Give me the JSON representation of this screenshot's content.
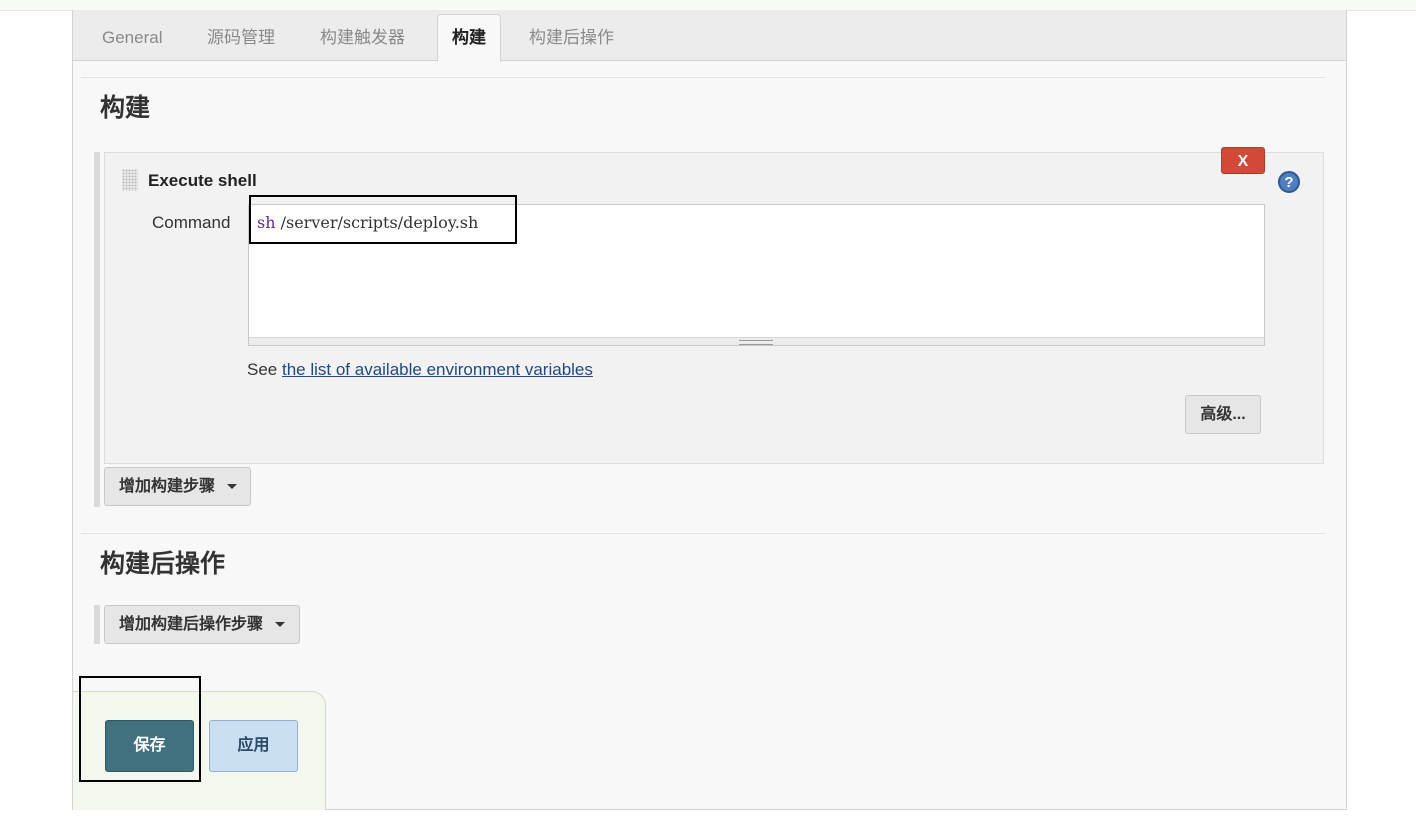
{
  "tabs": [
    {
      "label": "General"
    },
    {
      "label": "源码管理"
    },
    {
      "label": "构建触发器"
    },
    {
      "label": "构建",
      "active": true
    },
    {
      "label": "构建后操作"
    }
  ],
  "build": {
    "heading": "构建",
    "step": {
      "title": "Execute shell",
      "delete_label": "X",
      "help_label": "?",
      "command_label": "Command",
      "command_value_keyword": "sh",
      "command_value_rest": " /server/scripts/deploy.sh",
      "env_prefix": "See ",
      "env_link": "the list of available environment variables",
      "advanced_label": "高级..."
    },
    "add_step_label": "增加构建步骤"
  },
  "post_build": {
    "heading": "构建后操作",
    "add_step_label": "增加构建后操作步骤"
  },
  "actions": {
    "save_label": "保存",
    "apply_label": "应用"
  },
  "colors": {
    "delete_button": "#d24939",
    "save_button": "#41717f",
    "apply_button": "#cbdff2",
    "link": "#204a87",
    "help_icon": "#4f7fc0"
  }
}
